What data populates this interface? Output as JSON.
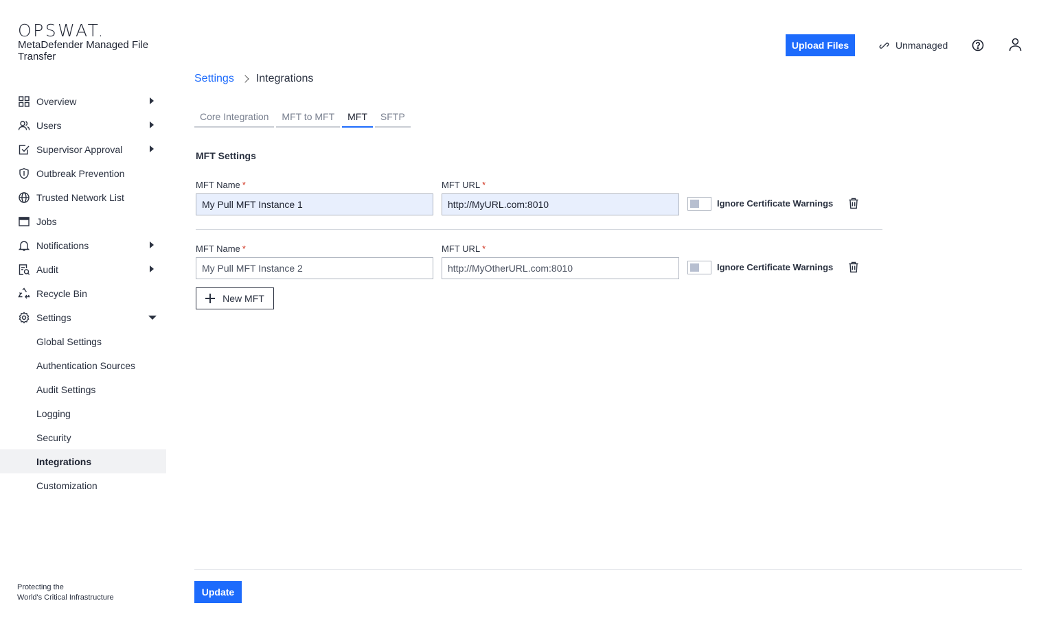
{
  "brand": {
    "logo_text": "OPSWAT",
    "logo_dot": ".",
    "product_name": "MetaDefender Managed File Transfer",
    "tagline_line1": "Protecting the",
    "tagline_line2": "World's Critical Infrastructure"
  },
  "header": {
    "upload_label": "Upload Files",
    "status_label": "Unmanaged"
  },
  "sidebar": {
    "items": [
      {
        "label": "Overview",
        "icon": "grid-icon",
        "expandable": true
      },
      {
        "label": "Users",
        "icon": "users-icon",
        "expandable": true
      },
      {
        "label": "Supervisor Approval",
        "icon": "checkbox-icon",
        "expandable": true
      },
      {
        "label": "Outbreak Prevention",
        "icon": "shield-icon",
        "expandable": false
      },
      {
        "label": "Trusted Network List",
        "icon": "globe-icon",
        "expandable": false
      },
      {
        "label": "Jobs",
        "icon": "window-icon",
        "expandable": false
      },
      {
        "label": "Notifications",
        "icon": "bell-icon",
        "expandable": true
      },
      {
        "label": "Audit",
        "icon": "audit-icon",
        "expandable": true
      },
      {
        "label": "Recycle Bin",
        "icon": "recycle-icon",
        "expandable": false
      },
      {
        "label": "Settings",
        "icon": "gear-icon",
        "expandable": true,
        "expanded": true
      }
    ],
    "settings_sub": [
      {
        "label": "Global Settings"
      },
      {
        "label": "Authentication Sources"
      },
      {
        "label": "Audit Settings"
      },
      {
        "label": "Logging"
      },
      {
        "label": "Security"
      },
      {
        "label": "Integrations",
        "active": true
      },
      {
        "label": "Customization"
      }
    ]
  },
  "breadcrumb": {
    "parent": "Settings",
    "current": "Integrations"
  },
  "tabs": [
    {
      "label": "Core Integration"
    },
    {
      "label": "MFT to MFT"
    },
    {
      "label": "MFT",
      "active": true
    },
    {
      "label": "SFTP"
    }
  ],
  "mft_settings": {
    "section_title": "MFT Settings",
    "name_label": "MFT Name",
    "url_label": "MFT URL",
    "required_mark": "*",
    "ignore_cert_label": "Ignore Certificate Warnings",
    "entries": [
      {
        "name": "My Pull MFT Instance 1",
        "url": "http://MyURL.com:8010",
        "ignore_cert": false
      },
      {
        "name": "My Pull MFT Instance 2",
        "url": "http://MyOtherURL.com:8010",
        "ignore_cert": false
      }
    ],
    "new_button_label": "New MFT"
  },
  "footer": {
    "update_label": "Update"
  },
  "colors": {
    "accent": "#1d6bfc",
    "required": "#d0321e",
    "filled_input_bg": "#e8effd"
  }
}
